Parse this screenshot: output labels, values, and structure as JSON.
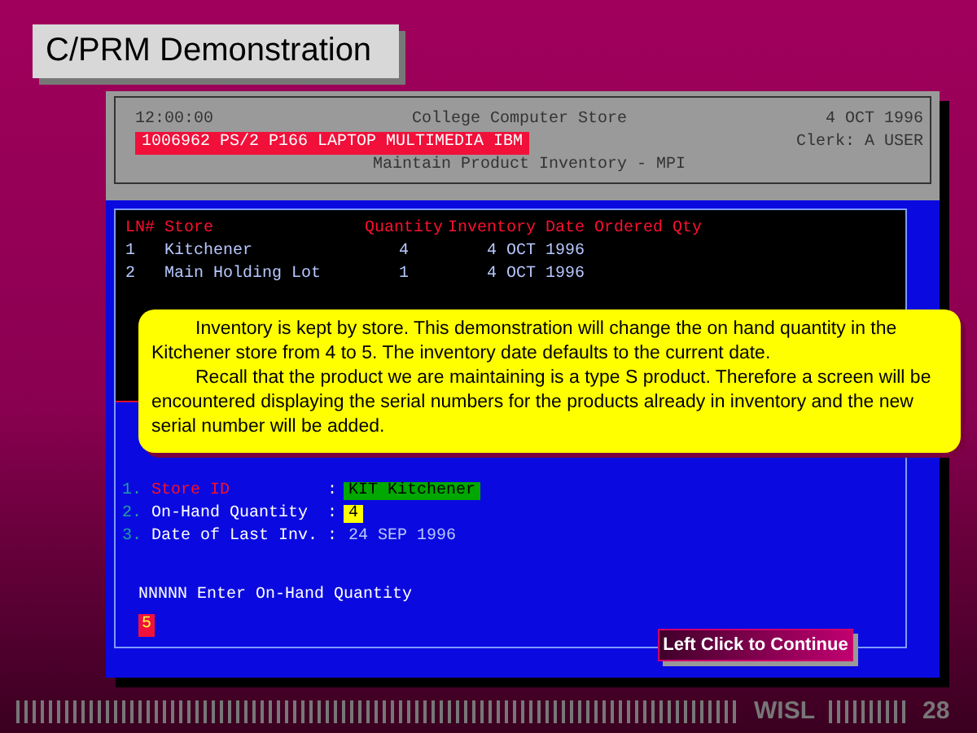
{
  "slide_title": "C/PRM Demonstration",
  "terminal": {
    "header": {
      "time": "12:00:00",
      "store_name": "College Computer Store",
      "date": "4 OCT 1996",
      "product": "1006962 PS/2 P166 LAPTOP MULTIMEDIA IBM",
      "clerk": "Clerk: A USER",
      "screen_title": "Maintain Product Inventory - MPI"
    },
    "table": {
      "columns": [
        "LN#",
        "Store",
        "Quantity",
        "Inventory Date",
        "Ordered Qty"
      ],
      "rows": [
        {
          "cells": [
            "1",
            "Kitchener",
            "4",
            "4 OCT 1996"
          ]
        },
        {
          "cells": [
            "2",
            "Main Holding Lot",
            "1",
            "4 OCT 1996"
          ]
        }
      ]
    },
    "fields": [
      {
        "number": "1.",
        "label": "Store ID",
        "separator": ":",
        "value": "KIT Kitchener",
        "selected": true,
        "color": "#00a800"
      },
      {
        "number": "2.",
        "label": "On-Hand Quantity",
        "separator": ":",
        "value": "4",
        "selected": false,
        "color": "#ffff00"
      },
      {
        "number": "3.",
        "label": "Date of Last Inv.",
        "separator": ":",
        "value": "24 SEP 1996",
        "selected": false
      }
    ],
    "prompt": {
      "text": "NNNNN Enter On-Hand Quantity",
      "value": "5"
    }
  },
  "callout": {
    "paragraphs": [
      "Inventory is kept by store. This demonstration will change the on hand quantity in the Kitchener store from 4 to 5. The inventory date defaults to the current date.",
      "Recall that the product we are maintaining is a type S product. Therefore a screen will be encountered displaying the serial numbers for the products already in inventory and the new serial number will be added."
    ]
  },
  "continue_button": "Left Click to Continue",
  "footer": {
    "label": "WISL",
    "page": "28"
  }
}
